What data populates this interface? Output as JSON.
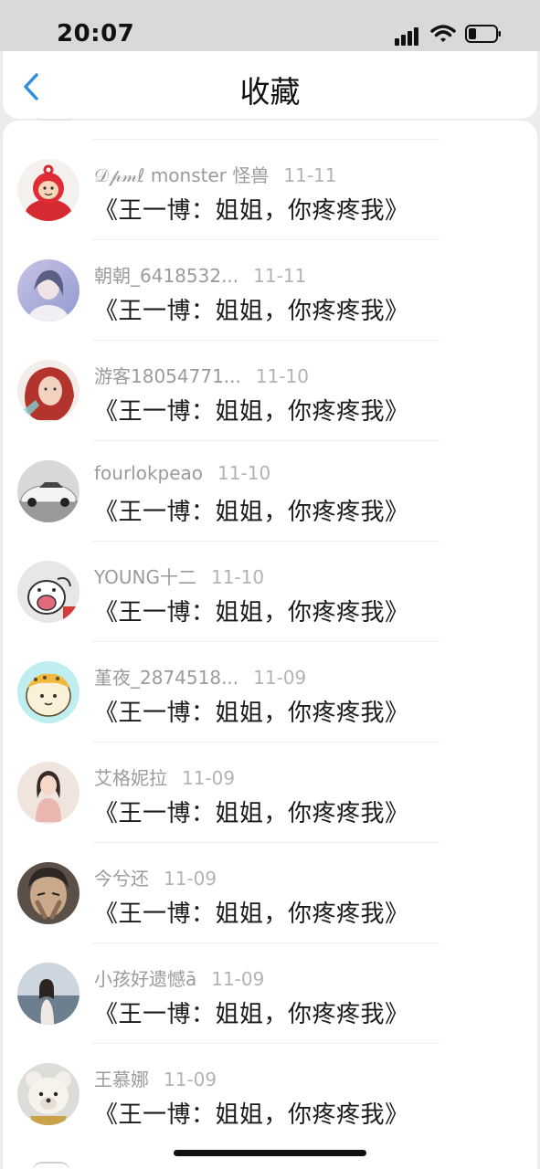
{
  "status_bar": {
    "time": "20:07"
  },
  "header": {
    "title": "收藏",
    "back_icon": "chevron-left-icon",
    "accent": "#2f8fdb"
  },
  "items": [
    {
      "user": "𝒟𝓅𝓂ℓ monster 怪兽",
      "date": "11-11",
      "message": "《王一博：姐姐，你疼疼我》",
      "avatar": "avatar-teletubby"
    },
    {
      "user": "朝朝_6418532...",
      "date": "11-11",
      "message": "《王一博：姐姐，你疼疼我》",
      "avatar": "avatar-girl-blue"
    },
    {
      "user": "游客18054771...",
      "date": "11-10",
      "message": "《王一博：姐姐，你疼疼我》",
      "avatar": "avatar-girl-redhair"
    },
    {
      "user": "fourlokpeao",
      "date": "11-10",
      "message": "《王一博：姐姐，你疼疼我》",
      "avatar": "avatar-car"
    },
    {
      "user": "YOUNG十二",
      "date": "11-10",
      "message": "《王一博：姐姐，你疼疼我》",
      "avatar": "avatar-cartoon-dog"
    },
    {
      "user": "堇夜_2874518...",
      "date": "11-09",
      "message": "《王一博：姐姐，你疼疼我》",
      "avatar": "avatar-cartoon-hamster"
    },
    {
      "user": "艾格妮拉",
      "date": "11-09",
      "message": "《王一博：姐姐，你疼疼我》",
      "avatar": "avatar-woman-pink"
    },
    {
      "user": "今兮还",
      "date": "11-09",
      "message": "《王一博：姐姐，你疼疼我》",
      "avatar": "avatar-cartoon-face"
    },
    {
      "user": "小孩好遗憾ā",
      "date": "11-09",
      "message": "《王一博：姐姐，你疼疼我》",
      "avatar": "avatar-girl-sea"
    },
    {
      "user": "王慕娜",
      "date": "11-09",
      "message": "《王一博：姐姐，你疼疼我》",
      "avatar": "avatar-teddy-bear"
    }
  ]
}
